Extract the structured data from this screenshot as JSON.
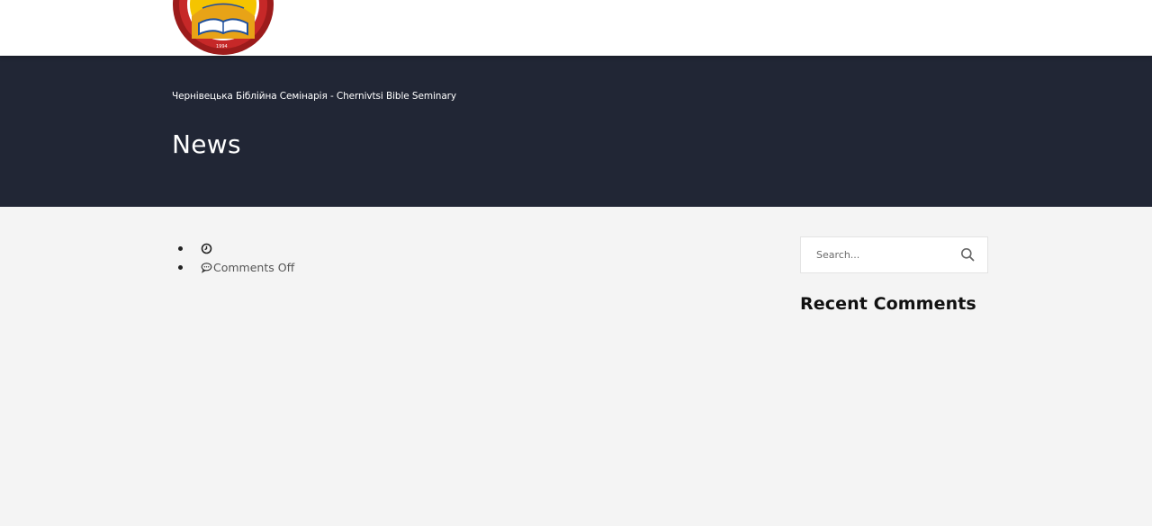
{
  "header": {
    "logo_year": "1994"
  },
  "hero": {
    "breadcrumb": "Чернівецька Біблійна Семінарія - Chernivtsi Bible Seminary",
    "title": "News"
  },
  "post_meta": {
    "date_icon": "clock-icon",
    "date_text": "",
    "comments_icon": "speech-bubble-icon",
    "comments_text": "Comments Off"
  },
  "sidebar": {
    "search": {
      "placeholder": "Search...",
      "value": "",
      "icon": "search-icon"
    },
    "recent_comments_title": "Recent Comments"
  },
  "colors": {
    "hero_bg": "#212635",
    "content_bg": "#f4f4f4",
    "header_bg": "#ffffff",
    "logo_red": "#b22222",
    "logo_yellow": "#f5c400"
  }
}
